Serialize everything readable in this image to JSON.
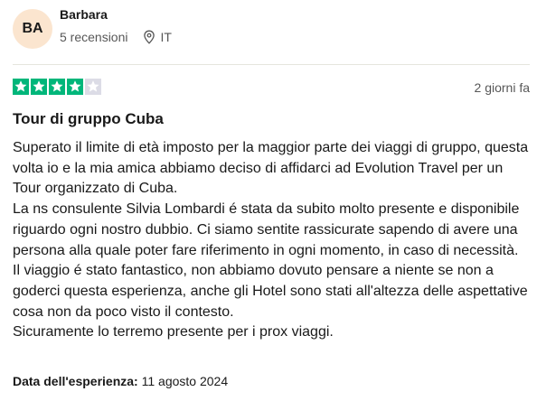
{
  "reviewer": {
    "initials": "BA",
    "name": "Barbara",
    "reviews_count": "5 recensioni",
    "country": "IT",
    "location_icon": "location-pin-icon"
  },
  "review": {
    "rating": 4,
    "rating_max": 5,
    "date": "2 giorni fa",
    "title": "Tour di gruppo Cuba",
    "paragraphs": [
      "Superato il limite di età imposto per la maggior parte dei viaggi di gruppo, questa volta io e la mia amica abbiamo deciso di affidarci ad Evolution Travel per un Tour organizzato di Cuba.",
      "La ns consulente Silvia Lombardi é stata da subito molto presente e disponibile riguardo ogni nostro dubbio. Ci siamo sentite rassicurate sapendo di avere una persona alla quale poter fare riferimento in ogni momento, in caso di necessità.",
      "Il viaggio é stato fantastico, non abbiamo dovuto pensare a niente se non a goderci questa esperienza, anche gli Hotel sono stati all'altezza delle aspettative cosa non da poco visto il contesto.",
      "Sicuramente lo terremo presente per i prox viaggi."
    ],
    "experience_label": "Data dell'esperienza:",
    "experience_date": "11 agosto 2024"
  },
  "colors": {
    "star_filled": "#00b67a",
    "star_empty": "#dcdce6",
    "avatar_bg": "#fbe5cf",
    "text_primary": "#191919",
    "text_secondary": "#575757"
  }
}
